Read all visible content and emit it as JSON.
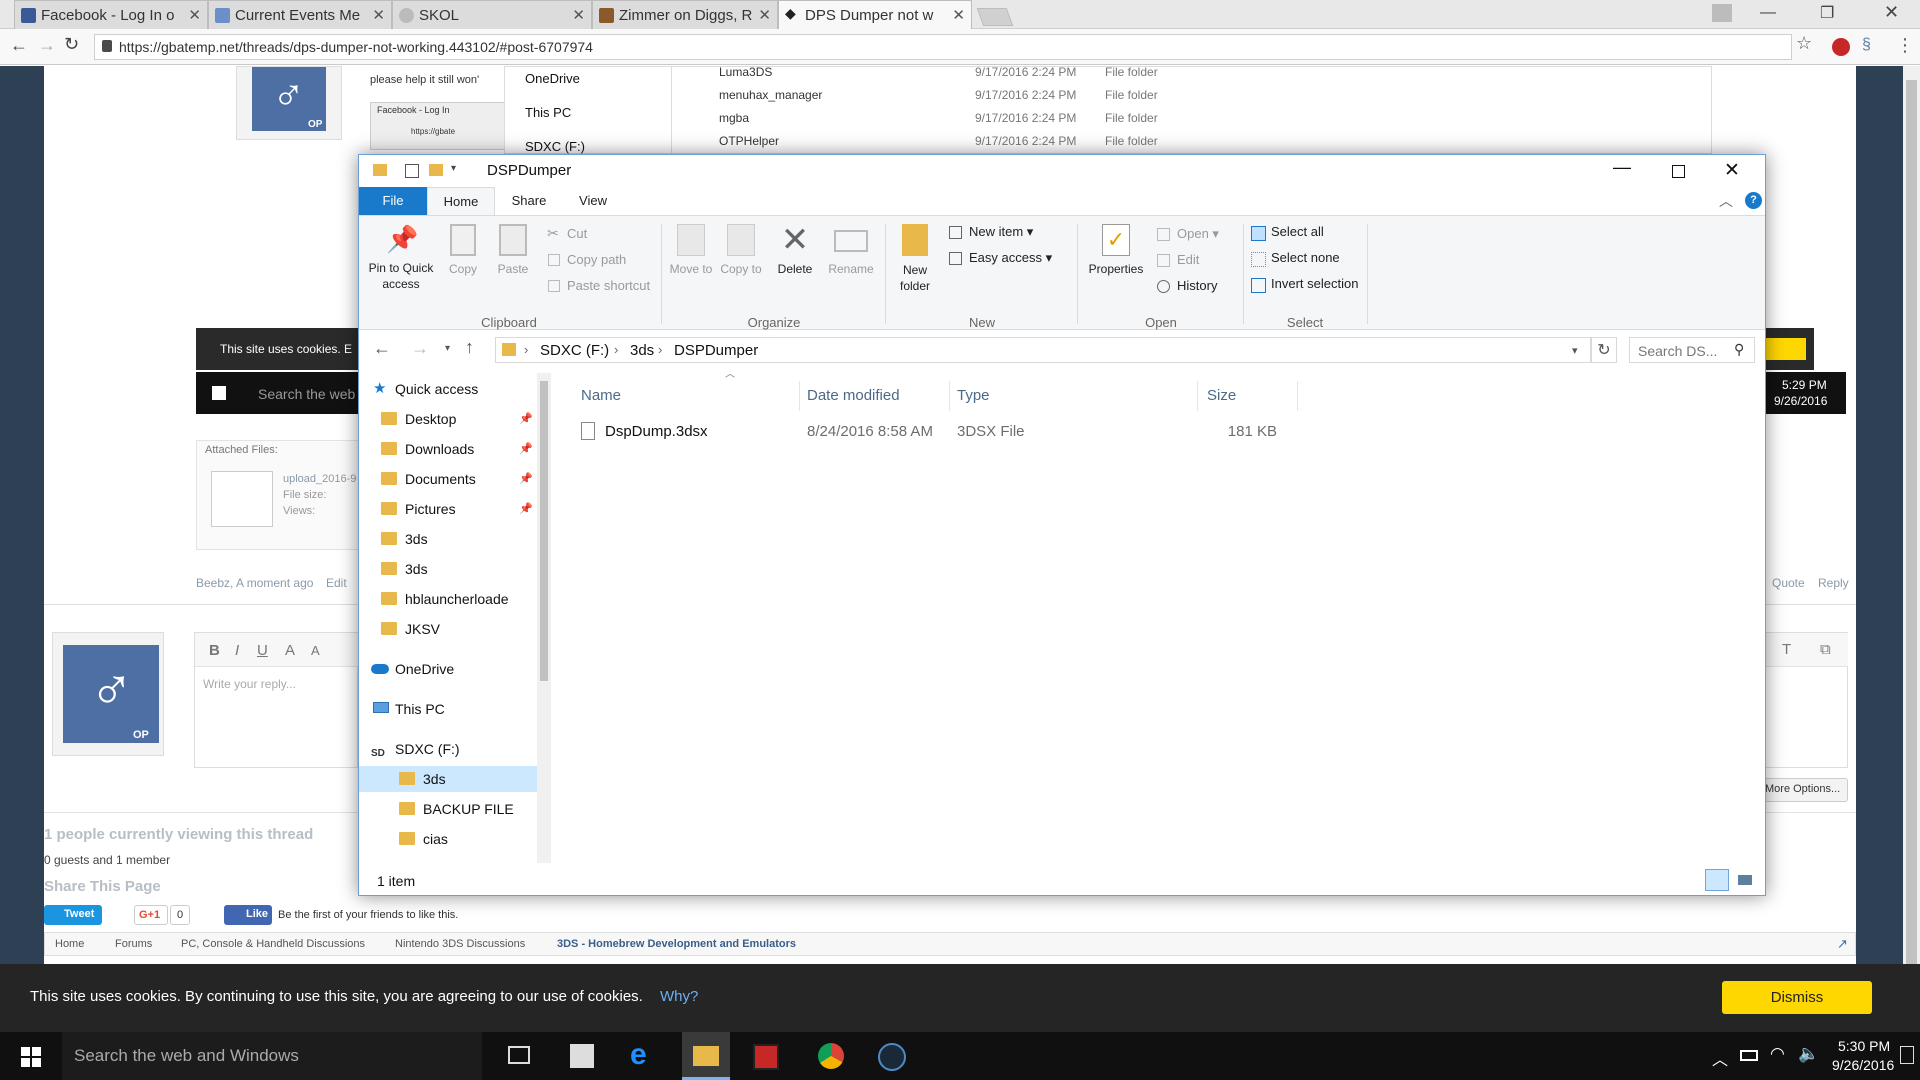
{
  "browser": {
    "tabs": [
      {
        "title": "Facebook - Log In o",
        "favicon_color": "#3b5998"
      },
      {
        "title": "Current Events Me",
        "favicon_color": "#6b8fc7"
      },
      {
        "title": "SKOL",
        "favicon_color": "#888888"
      },
      {
        "title": "Zimmer on Diggs, R",
        "favicon_color": "#8b5a2b"
      },
      {
        "title": "DPS Dumper not w",
        "favicon_color": "#d03030"
      }
    ],
    "active_tab": 4,
    "url": "https://gbatemp.net/threads/dps-dumper-not-working.443102/#post-6707974",
    "url_host": "gbatemp.net",
    "profile_name": "Beebz"
  },
  "forum": {
    "post_text": "please help it still won'",
    "nav_onedrive": "OneDrive",
    "nav_thispc": "This PC",
    "nav_sdxc": "SDXC (F:)",
    "bg_rows": [
      {
        "name": "Luma3DS",
        "date": "9/17/2016 2:24 PM",
        "type": "File folder"
      },
      {
        "name": "menuhax_manager",
        "date": "9/17/2016 2:24 PM",
        "type": "File folder"
      },
      {
        "name": "mgba",
        "date": "9/17/2016 2:24 PM",
        "type": "File folder"
      },
      {
        "name": "OTPHelper",
        "date": "9/17/2016 2:24 PM",
        "type": "File folder"
      }
    ],
    "screenshot_tab": "Facebook - Log In",
    "screenshot_url": "https://gbate",
    "cookie_inline": "This site uses cookies. E",
    "search_inline": "Search the web",
    "inline_time": "5:29 PM",
    "inline_date": "9/26/2016",
    "attached_files": "Attached Files:",
    "upload_name": "upload_2016-9",
    "file_size": "File size:",
    "views": "Views:",
    "post_meta_author": "Beebz, A moment ago",
    "post_meta_edit": "Edit",
    "quote": "Quote",
    "reply": "Reply",
    "op_badge": "OP",
    "editor_placeholder": "Write your reply...",
    "editor_buttons": [
      "B",
      "I",
      "U",
      "A",
      "A"
    ],
    "more_options": "More Options...",
    "viewing_title": "1 people currently viewing this thread",
    "viewing_sub": "0 guests and 1 member",
    "share_title": "Share This Page",
    "tweet": "Tweet",
    "gplus": "G+1",
    "gplus_count": "0",
    "like": "Like",
    "like_text": "Be the first of your friends to like this.",
    "breadcrumbs": [
      "Home",
      "Forums",
      "PC, Console & Handheld Discussions",
      "Nintendo 3DS Discussions",
      "3DS - Homebrew Development and Emulators"
    ]
  },
  "cookie_bar": {
    "text": "This site uses cookies. By continuing to use this site, you are agreeing to our use of cookies.",
    "link": "Why?",
    "dismiss": "Dismiss"
  },
  "explorer": {
    "title": "DSPDumper",
    "tabs": [
      "File",
      "Home",
      "Share",
      "View"
    ],
    "active_tab": "Home",
    "clipboard": {
      "pin": "Pin to Quick access",
      "copy": "Copy",
      "paste": "Paste",
      "cut": "Cut",
      "copy_path": "Copy path",
      "paste_shortcut": "Paste shortcut",
      "group": "Clipboard"
    },
    "organize": {
      "move_to": "Move to",
      "copy_to": "Copy to",
      "delete": "Delete",
      "rename": "Rename",
      "group": "Organize"
    },
    "new": {
      "new_folder": "New folder",
      "new_item": "New item",
      "easy_access": "Easy access",
      "group": "New"
    },
    "open": {
      "properties": "Properties",
      "open": "Open",
      "edit": "Edit",
      "history": "History",
      "group": "Open"
    },
    "select": {
      "select_all": "Select all",
      "select_none": "Select none",
      "invert": "Invert selection",
      "group": "Select"
    },
    "breadcrumb": [
      "SDXC (F:)",
      "3ds",
      "DSPDumper"
    ],
    "search_placeholder": "Search DS...",
    "nav": [
      {
        "label": "Quick access",
        "kind": "star"
      },
      {
        "label": "Desktop",
        "kind": "folder",
        "pinned": true
      },
      {
        "label": "Downloads",
        "kind": "folder",
        "pinned": true
      },
      {
        "label": "Documents",
        "kind": "folder",
        "pinned": true
      },
      {
        "label": "Pictures",
        "kind": "folder",
        "pinned": true
      },
      {
        "label": "3ds",
        "kind": "folder"
      },
      {
        "label": "3ds",
        "kind": "folder"
      },
      {
        "label": "hblauncherloade",
        "kind": "folder"
      },
      {
        "label": "JKSV",
        "kind": "folder"
      },
      {
        "label": "OneDrive",
        "kind": "cloud"
      },
      {
        "label": "This PC",
        "kind": "pc"
      },
      {
        "label": "SDXC (F:)",
        "kind": "sd"
      },
      {
        "label": "3ds",
        "kind": "folder",
        "selected": true
      },
      {
        "label": "BACKUP FILE",
        "kind": "folder"
      },
      {
        "label": "cias",
        "kind": "folder"
      }
    ],
    "columns": [
      "Name",
      "Date modified",
      "Type",
      "Size"
    ],
    "files": [
      {
        "name": "DspDump.3dsx",
        "date": "8/24/2016 8:58 AM",
        "type": "3DSX File",
        "size": "181 KB"
      }
    ],
    "status": "1 item"
  },
  "taskbar": {
    "search": "Search the web and Windows",
    "time": "5:30 PM",
    "date": "9/26/2016"
  },
  "colors": {
    "accent": "#1979ca",
    "selection": "#cce8ff",
    "folder": "#e8b94a",
    "cookie_button": "#ffd700",
    "page_bg": "#2e4053"
  }
}
